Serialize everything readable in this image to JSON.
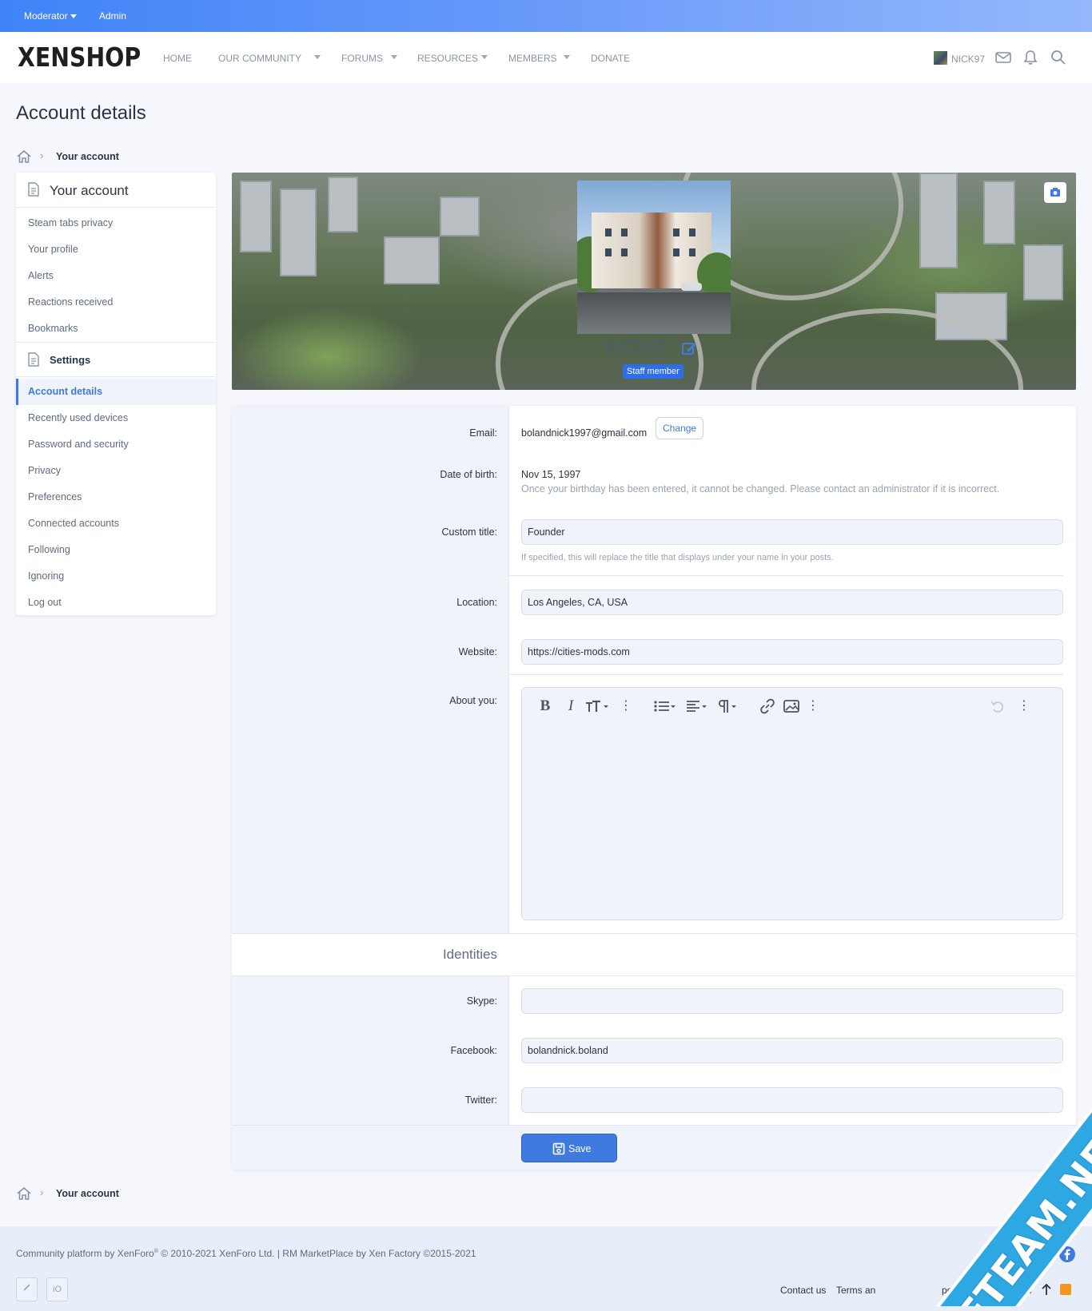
{
  "topbar": {
    "moderator": "Moderator",
    "admin": "Admin"
  },
  "header": {
    "logo": "XENSHOP",
    "nav": [
      "HOME",
      "OUR COMMUNITY",
      "FORUMS",
      "RESOURCES",
      "MEMBERS",
      "DONATE"
    ],
    "username": "NICK97"
  },
  "page": {
    "title": "Account details",
    "breadcrumb": "Your account"
  },
  "sidebar": {
    "account_header": "Your account",
    "account_items": [
      "Steam tabs privacy",
      "Your profile",
      "Alerts",
      "Reactions received",
      "Bookmarks"
    ],
    "settings_header": "Settings",
    "settings_items": [
      "Account details",
      "Recently used devices",
      "Password and security",
      "Privacy",
      "Preferences",
      "Connected accounts",
      "Following",
      "Ignoring",
      "Log out"
    ],
    "active_item": "Account details"
  },
  "banner": {
    "username": "NICK97",
    "badge": "Staff member"
  },
  "form": {
    "email_label": "Email:",
    "email_value": "bolandnick1997@gmail.com",
    "change_label": "Change",
    "dob_label": "Date of birth:",
    "dob_value": "Nov 15, 1997",
    "dob_hint": "Once your birthday has been entered, it cannot be changed. Please contact an administrator if it is incorrect.",
    "custom_title_label": "Custom title:",
    "custom_title_value": "Founder",
    "custom_title_hint": "If specified, this will replace the title that displays under your name in your posts.",
    "location_label": "Location:",
    "location_value": "Los Angeles, CA, USA",
    "website_label": "Website:",
    "website_value": "https://cities-mods.com",
    "about_label": "About you:",
    "identities_label": "Identities",
    "skype_label": "Skype:",
    "skype_value": "",
    "facebook_label": "Facebook:",
    "facebook_value": "bolandnick.boland",
    "twitter_label": "Twitter:",
    "twitter_value": "",
    "save_label": "Save"
  },
  "footer": {
    "copyright_prefix": "Community platform by XenForo",
    "copyright_suffix": " © 2010-2021 XenForo Ltd. | RM MarketPlace by Xen Factory ©2015-2021",
    "links": [
      "Contact us",
      "Terms an",
      "policy",
      "Help",
      "Home"
    ],
    "io_label": "iO"
  },
  "watermark": "XFTEAM.NET",
  "colors": {
    "accent": "#3f7ae0",
    "topbar": "#3f83f8",
    "watermark": "#2ea8e2"
  }
}
